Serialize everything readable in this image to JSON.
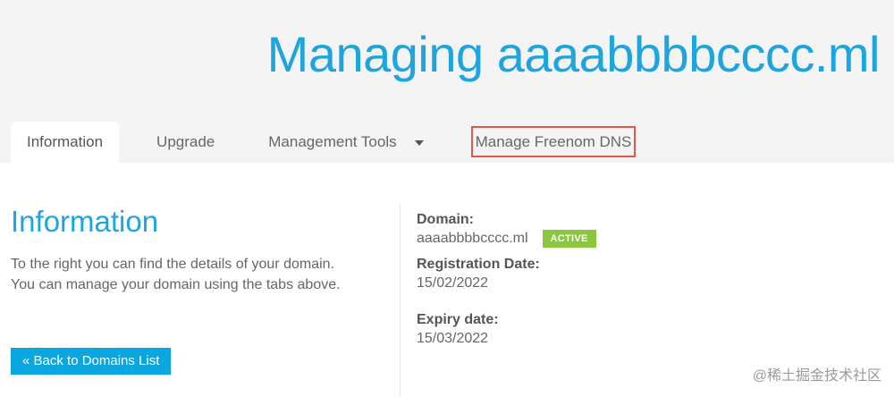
{
  "header": {
    "title": "Managing aaaabbbbcccc.ml"
  },
  "tabs": [
    {
      "label": "Information",
      "active": true
    },
    {
      "label": "Upgrade",
      "active": false
    },
    {
      "label": "Management Tools",
      "active": false,
      "icon": "caret-down-icon"
    },
    {
      "label": "Manage Freenom DNS",
      "active": false,
      "highlighted": true
    }
  ],
  "info": {
    "heading": "Information",
    "description_line1": "To the right you can find the details of your domain.",
    "description_line2": "You can manage your domain using the tabs above.",
    "back_button_label": "« Back to Domains List"
  },
  "details": {
    "domain_label": "Domain:",
    "domain_value": "aaaabbbbcccc.ml",
    "status_badge": "ACTIVE",
    "registration_label": "Registration Date:",
    "registration_value": "15/02/2022",
    "expiry_label": "Expiry date:",
    "expiry_value": "15/03/2022"
  },
  "watermark": "@稀土掘金技术社区",
  "colors": {
    "accent": "#1ea5de",
    "button": "#0aa6e0",
    "status_active": "#8cc63f",
    "highlight_border": "#e2574c"
  }
}
